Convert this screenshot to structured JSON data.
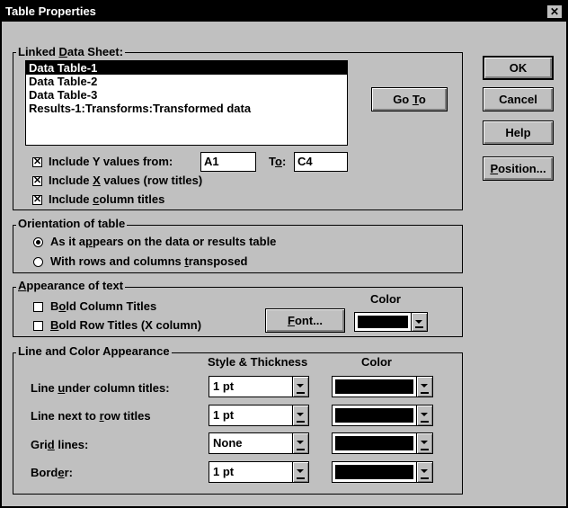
{
  "title": "Table Properties",
  "close_glyph": "✕",
  "linked": {
    "legend": "Linked Data Sheet:",
    "items": [
      "Data Table-1",
      "Data Table-2",
      "Data Table-3",
      "Results-1:Transforms:Transformed data"
    ],
    "selected_index": 0,
    "goto_label": "Go To",
    "include_y_label": "Include Y values from:",
    "include_y_checked": true,
    "from_value": "A1",
    "to_label": "To:",
    "to_value": "C4",
    "include_x_label": "Include X values (row titles)",
    "include_x_checked": true,
    "include_col_label": "Include column titles",
    "include_col_checked": true
  },
  "orientation": {
    "legend": "Orientation of table",
    "opt1": "As it appears on the data or results table",
    "opt2": "With rows and columns transposed",
    "selected": "opt1"
  },
  "appearance": {
    "legend": "Appearance of text",
    "bold_col": "Bold Column Titles",
    "bold_row": "Bold Row Titles (X column)",
    "bold_col_checked": false,
    "bold_row_checked": false,
    "color_header": "Color",
    "font_button": "Font...",
    "text_color": "#000000"
  },
  "lines": {
    "legend": "Line and Color Appearance",
    "style_header": "Style & Thickness",
    "color_header": "Color",
    "rows": [
      {
        "label": "Line under column titles:",
        "style": "1 pt",
        "color": "#000000"
      },
      {
        "label": "Line next to row titles",
        "style": "1 pt",
        "color": "#000000"
      },
      {
        "label": "Grid lines:",
        "style": "None",
        "color": "#000000"
      },
      {
        "label": "Border:",
        "style": "1 pt",
        "color": "#000000"
      }
    ]
  },
  "buttons": {
    "ok": "OK",
    "cancel": "Cancel",
    "help": "Help",
    "position": "Position..."
  }
}
